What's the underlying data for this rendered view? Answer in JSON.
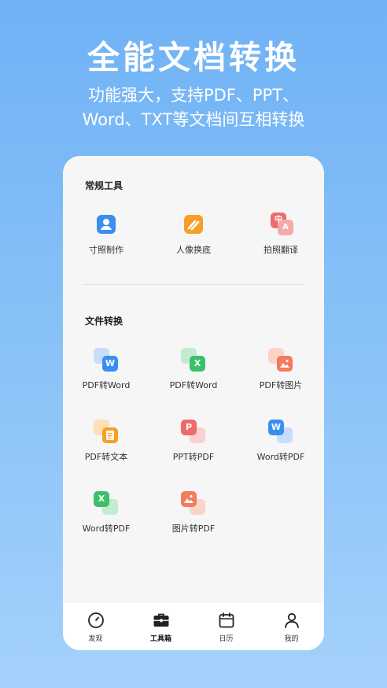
{
  "hero": {
    "title": "全能文档转换",
    "subtitle_line1": "功能强大，支持PDF、PPT、",
    "subtitle_line2": "Word、TXT等文档间互相转换"
  },
  "sections": {
    "common_tools": {
      "title": "常规工具",
      "items": [
        {
          "label": "寸照制作",
          "icon": "id-photo-icon"
        },
        {
          "label": "人像换底",
          "icon": "portrait-bg-icon"
        },
        {
          "label": "拍照翻译",
          "icon": "photo-translate-icon"
        }
      ]
    },
    "file_convert": {
      "title": "文件转换",
      "items": [
        {
          "label": "PDF转Word",
          "icon": "pdf-to-word-icon"
        },
        {
          "label": "PDF转Word",
          "icon": "pdf-to-excel-icon"
        },
        {
          "label": "PDF转图片",
          "icon": "pdf-to-image-icon"
        },
        {
          "label": "PDF转文本",
          "icon": "pdf-to-text-icon"
        },
        {
          "label": "PPT转PDF",
          "icon": "ppt-to-pdf-icon"
        },
        {
          "label": "Word转PDF",
          "icon": "word-to-pdf-icon"
        },
        {
          "label": "Word转PDF",
          "icon": "excel-to-pdf-icon"
        },
        {
          "label": "图片转PDF",
          "icon": "image-to-pdf-icon"
        }
      ]
    }
  },
  "icon_glyphs": {
    "word": "W",
    "excel": "X",
    "ppt": "P",
    "translate_zh": "中",
    "translate_en": "A"
  },
  "tabbar": {
    "items": [
      {
        "label": "发现",
        "icon": "compass-icon"
      },
      {
        "label": "工具箱",
        "icon": "toolbox-icon",
        "active": true
      },
      {
        "label": "日历",
        "icon": "calendar-icon"
      },
      {
        "label": "我的",
        "icon": "profile-icon"
      }
    ]
  },
  "colors": {
    "background_top": "#6fb2f6",
    "background_bottom": "#a4d1fb",
    "blue": "#3a8ef0",
    "orange": "#f5a025",
    "red": "#ef6b6b",
    "green": "#3cc06a",
    "card": "#f6f6f6"
  }
}
